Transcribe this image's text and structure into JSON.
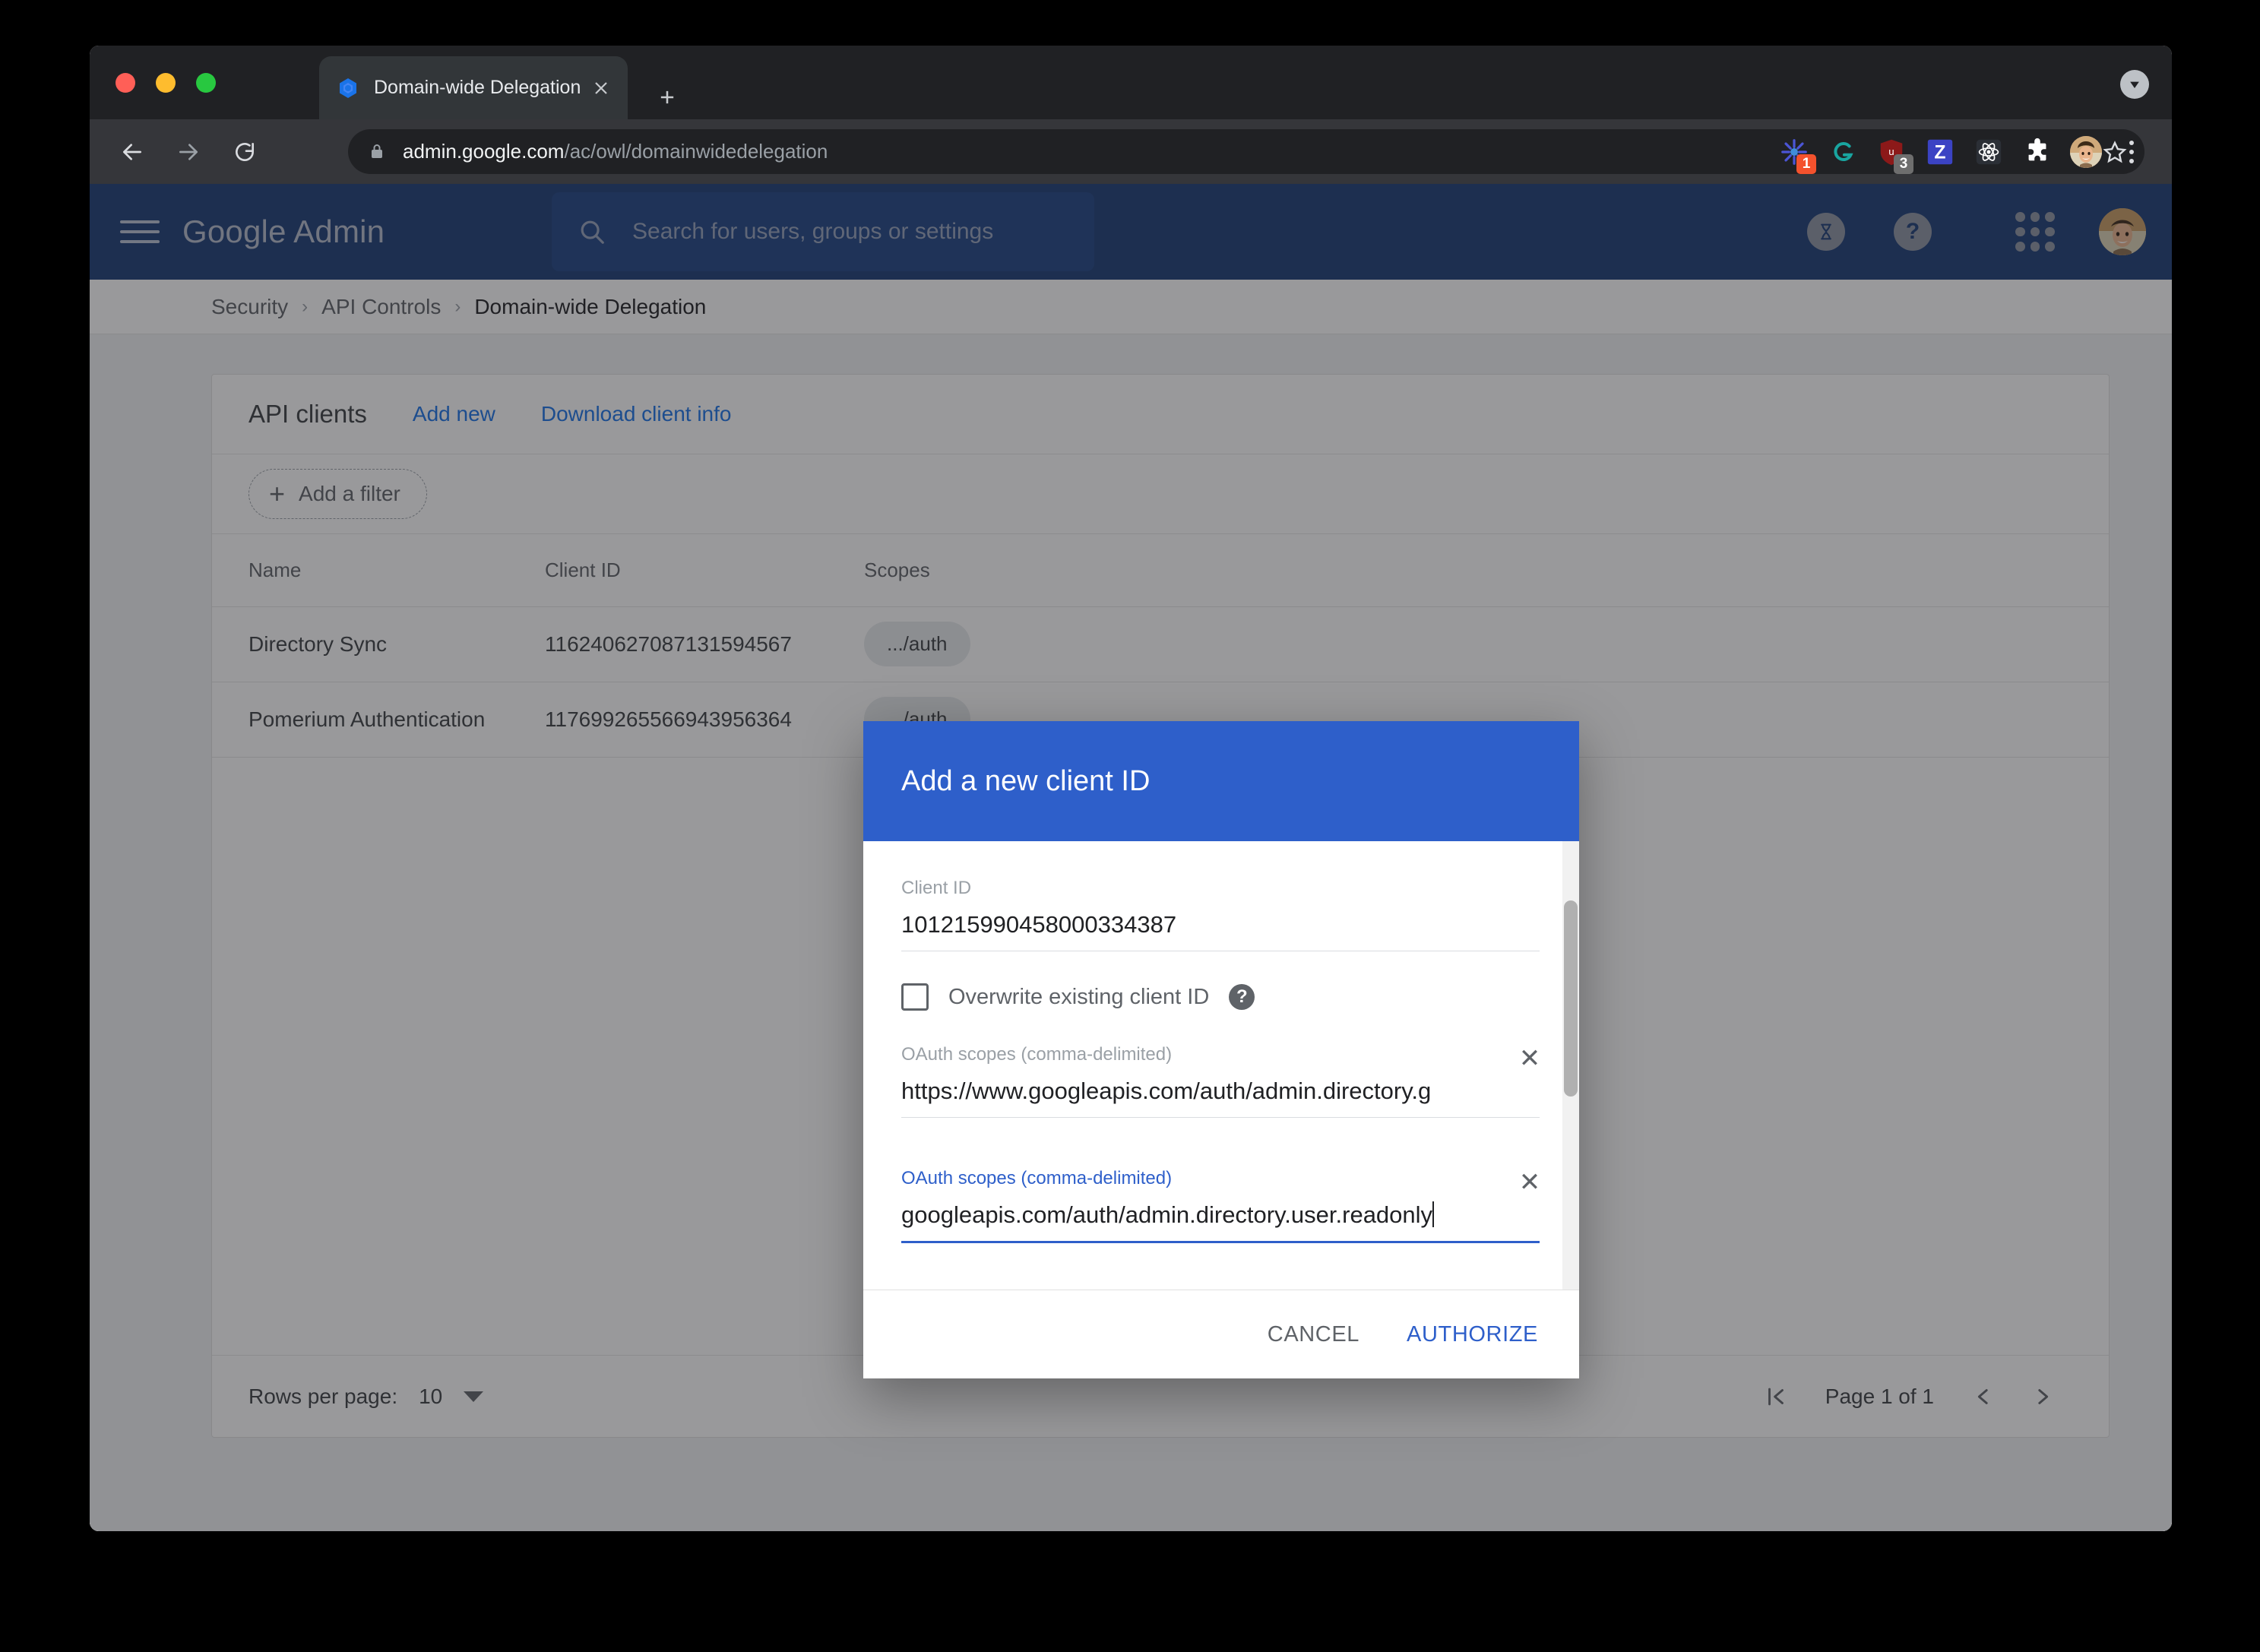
{
  "browser": {
    "tab": {
      "title": "Domain-wide Delegation",
      "favicon_icon": "google-cloud-favicon",
      "close_icon": "close-icon",
      "new_tab_icon": "plus-icon"
    },
    "downloads_icon": "download-arrow-icon",
    "nav": {
      "back_icon": "arrow-back-icon",
      "forward_icon": "arrow-forward-icon",
      "reload_icon": "reload-icon"
    },
    "omnibox": {
      "lock_icon": "lock-icon",
      "url_host": "admin.google.com",
      "url_path": "/ac/owl/domainwidedelegation",
      "star_icon": "star-icon"
    },
    "extensions": [
      {
        "name": "colorful-star-extension-icon",
        "badge": "1",
        "badge_color": "#f4522d"
      },
      {
        "name": "grammarly-extension-icon",
        "badge": "",
        "badge_color": ""
      },
      {
        "name": "ublock-origin-extension-icon",
        "badge": "3",
        "badge_color": "#6e6e6e"
      },
      {
        "name": "zotero-extension-icon",
        "badge": "",
        "badge_color": ""
      },
      {
        "name": "react-devtools-extension-icon",
        "badge": "",
        "badge_color": ""
      },
      {
        "name": "extensions-puzzle-icon",
        "badge": "",
        "badge_color": ""
      }
    ],
    "profile_avatar": "profile-avatar",
    "menu_icon": "three-dot-menu-icon"
  },
  "admin_header": {
    "hamburger_icon": "hamburger-menu-icon",
    "logo_text": "Google Admin",
    "search": {
      "icon": "search-icon",
      "placeholder": "Search for users, groups or settings",
      "value": ""
    },
    "hourglass_icon": "hourglass-icon",
    "help_icon": "help-question-icon",
    "apps_icon": "apps-grid-icon",
    "avatar": "admin-profile-avatar"
  },
  "breadcrumb": {
    "items": [
      {
        "label": "Security",
        "current": false
      },
      {
        "label": "API Controls",
        "current": false
      },
      {
        "label": "Domain-wide Delegation",
        "current": true
      }
    ],
    "separator": "›"
  },
  "api_clients": {
    "title": "API clients",
    "add_new_label": "Add new",
    "download_label": "Download client info",
    "filter": {
      "plus_icon": "plus-icon",
      "label": "Add a filter"
    },
    "columns": [
      "Name",
      "Client ID",
      "Scopes"
    ],
    "rows": [
      {
        "name": "Directory Sync",
        "client_id": "116240627087131594567",
        "scopes_chip": ".../auth"
      },
      {
        "name": "Pomerium Authentication",
        "client_id": "117699265566943956364",
        "scopes_chip": ".../auth"
      }
    ],
    "pagination": {
      "rows_per_page_label": "Rows per page:",
      "rows_per_page_value": "10",
      "dropdown_icon": "chevron-down-icon",
      "first_page_icon": "first-page-icon",
      "prev_page_icon": "chevron-left-icon",
      "next_page_icon": "chevron-right-icon",
      "page_label": "Page 1 of 1"
    }
  },
  "dialog": {
    "title": "Add a new client ID",
    "client_id_field": {
      "label": "Client ID",
      "value": "101215990458000334387"
    },
    "overwrite": {
      "label": "Overwrite existing client ID",
      "checked": false,
      "help_icon": "help-question-icon",
      "help_glyph": "?"
    },
    "scope_fields": [
      {
        "label": "OAuth scopes (comma-delimited)",
        "value": "https://www.googleapis.com/auth/admin.directory.g",
        "focused": false,
        "clear_icon": "close-icon",
        "clear_glyph": "✕"
      },
      {
        "label": "OAuth scopes (comma-delimited)",
        "value": "googleapis.com/auth/admin.directory.user.readonly",
        "focused": true,
        "clear_icon": "close-icon",
        "clear_glyph": "✕"
      }
    ],
    "cancel_label": "CANCEL",
    "authorize_label": "AUTHORIZE",
    "colors": {
      "header_blue": "#2e5fca",
      "accent_blue": "#2e5fca"
    }
  }
}
